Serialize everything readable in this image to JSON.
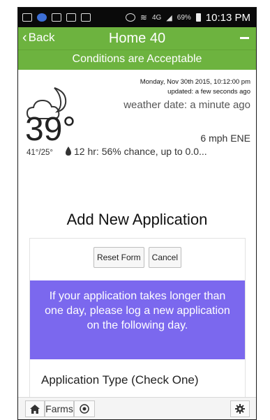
{
  "status_bar": {
    "network": "4G",
    "battery": "69%",
    "time": "10:13 PM"
  },
  "header": {
    "back_label": "Back",
    "title": "Home 40",
    "back_icon": "chevron-left-icon",
    "menu_icon": "minus-icon"
  },
  "conditions": {
    "text": "Conditions are Acceptable"
  },
  "weather": {
    "date": "Monday, Nov 30th 2015, 10:12:00 pm",
    "updated": "updated: a few seconds ago",
    "weather_date": "weather date: a minute ago",
    "temperature": "39°",
    "hi_lo": "41°/25°",
    "wind": "6 mph ENE",
    "rain": "12 hr: 56% chance, up to 0.0..."
  },
  "application": {
    "title": "Add New Application",
    "reset_label": "Reset Form",
    "cancel_label": "Cancel",
    "notice": "If your application takes longer than one day, please log a new application on the following day.",
    "type_label": "Application Type (Check One)"
  },
  "bottom_bar": {
    "farms_label": "Farms"
  },
  "colors": {
    "header_green": "#6db33f",
    "notice_purple": "#7b68ee"
  }
}
